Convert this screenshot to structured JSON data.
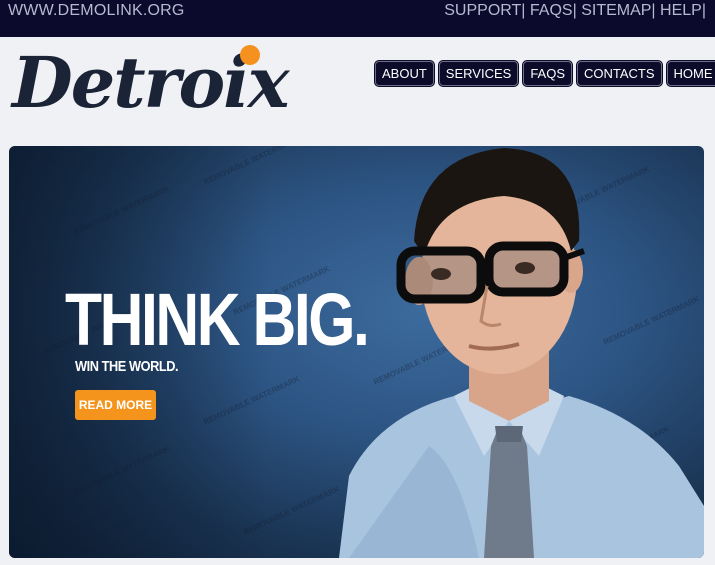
{
  "topbar": {
    "site": "WWW.DEMOLINK.ORG",
    "links": [
      "SUPPORT|",
      " FAQS|",
      " SITEMAP|",
      " HELP|"
    ]
  },
  "logo": {
    "text": "Detroix"
  },
  "nav": {
    "items": [
      "ABOUT",
      "SERVICES",
      "FAQS",
      "CONTACTS",
      "HOME"
    ]
  },
  "hero": {
    "headline": "THINK BIG.",
    "subline": "WIN THE WORLD.",
    "cta": "READ MORE",
    "watermark": "REMOVABLE WATERMARK"
  },
  "colors": {
    "topbar_bg": "#0c0a2c",
    "accent": "#f5941c",
    "nav_bg": "#0d0b2a"
  }
}
